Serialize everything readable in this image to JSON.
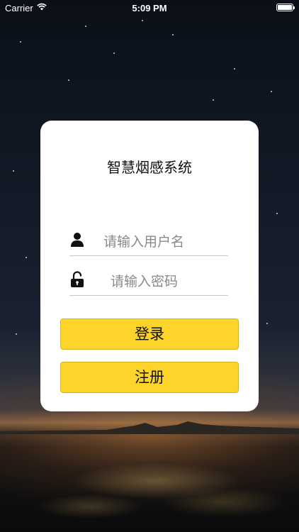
{
  "status_bar": {
    "carrier": "Carrier",
    "time": "5:09 PM",
    "wifi_icon": "wifi-icon",
    "battery_icon": "battery-icon"
  },
  "login": {
    "title": "智慧烟感系统",
    "username": {
      "placeholder": "请输入用户名",
      "value": "",
      "icon": "user-icon"
    },
    "password": {
      "placeholder": "请输入密码",
      "value": "",
      "icon": "unlock-icon"
    },
    "login_button": "登录",
    "register_button": "注册"
  },
  "colors": {
    "button_yellow": "#fdd42a",
    "card_background": "#ffffff"
  }
}
